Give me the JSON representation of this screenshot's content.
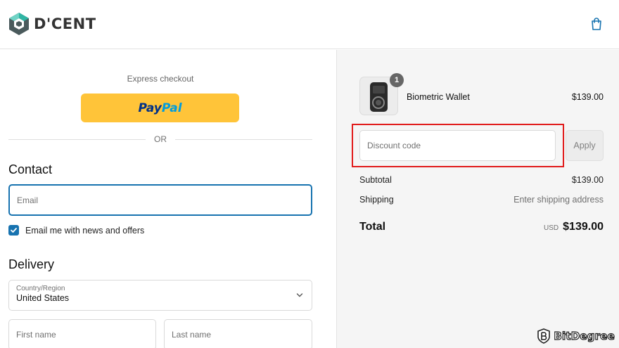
{
  "header": {
    "brand": "D'CENT",
    "cart_icon": "shopping-bag-icon"
  },
  "checkout": {
    "express_label": "Express checkout",
    "paypal_pay": "Pay",
    "paypal_pal": "Pal",
    "or_label": "OR",
    "contact_heading": "Contact",
    "email_placeholder": "Email",
    "news_checkbox_label": "Email me with news and offers",
    "news_checked": true,
    "delivery_heading": "Delivery",
    "country_label": "Country/Region",
    "country_value": "United States",
    "first_name_placeholder": "First name",
    "last_name_placeholder": "Last name"
  },
  "summary": {
    "item": {
      "name": "Biometric Wallet",
      "price": "$139.00",
      "quantity": "1"
    },
    "discount_placeholder": "Discount code",
    "apply_label": "Apply",
    "subtotal_label": "Subtotal",
    "subtotal_value": "$139.00",
    "shipping_label": "Shipping",
    "shipping_value": "Enter shipping address",
    "total_label": "Total",
    "total_currency": "USD",
    "total_value": "$139.00"
  },
  "watermark": {
    "text": "BitDegree"
  },
  "colors": {
    "accent": "#1773b0",
    "paypal_yellow": "#ffc439",
    "highlight_red": "#e11b1b",
    "summary_bg": "#f5f5f5"
  }
}
